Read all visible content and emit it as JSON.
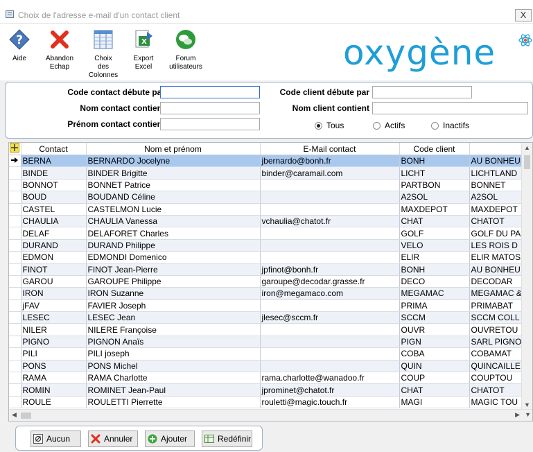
{
  "window": {
    "title": "Choix de l'adresse e-mail d'un contact client",
    "close_label": "X"
  },
  "toolbar": {
    "buttons": [
      {
        "id": "help",
        "label": "Aide",
        "icon": "help-icon"
      },
      {
        "id": "cancel",
        "label": "Abandon\nEchap",
        "icon": "cancel-icon"
      },
      {
        "id": "columns",
        "label": "Choix\ndes\nColonnes",
        "icon": "columns-icon"
      },
      {
        "id": "excel",
        "label": "Export\nExcel",
        "icon": "excel-export-icon"
      },
      {
        "id": "forum",
        "label": "Forum\nutilisateurs",
        "icon": "forum-icon"
      }
    ],
    "logo": "oxygène"
  },
  "filters": {
    "code_contact_label": "Code contact débute par",
    "code_contact_value": "",
    "nom_contact_label": "Nom contact contient",
    "nom_contact_value": "",
    "prenom_contact_label": "Prénom contact contient",
    "prenom_contact_value": "",
    "code_client_label": "Code client débute par",
    "code_client_value": "",
    "nom_client_label": "Nom client contient",
    "nom_client_value": "",
    "radios": [
      {
        "label": "Tous",
        "checked": true
      },
      {
        "label": "Actifs",
        "checked": false
      },
      {
        "label": "Inactifs",
        "checked": false
      }
    ]
  },
  "grid": {
    "columns": [
      "Contact",
      "Nom et prénom",
      "E-Mail contact",
      "Code client",
      ""
    ],
    "rows": [
      [
        "BERNA",
        "BERNARDO Jocelyne",
        "jbernardo@bonh.fr",
        "BONH",
        "AU BONHEUR"
      ],
      [
        "BINDE",
        "BINDER Brigitte",
        "binder@caramail.com",
        "LICHT",
        "LICHTLAND"
      ],
      [
        "BONNOT",
        "BONNET Patrice",
        "",
        "PARTBON",
        "BONNET"
      ],
      [
        "BOUD",
        "BOUDAND Céline",
        "",
        "A2SOL",
        "A2SOL"
      ],
      [
        "CASTEL",
        "CASTELMON Lucie",
        "",
        "MAXDEPOT",
        "MAXDEPOT"
      ],
      [
        "CHAULIA",
        "CHAULIA Vanessa",
        "vchaulia@chatot.fr",
        "CHAT",
        "CHATOT"
      ],
      [
        "DELAF",
        "DELAFORET Charles",
        "",
        "GOLF",
        "GOLF DU PA"
      ],
      [
        "DURAND",
        "DURAND Philippe",
        "",
        "VELO",
        "LES ROIS D"
      ],
      [
        "EDMON",
        "EDMONDI Domenico",
        "",
        "ELIR",
        "ELIR MATOS"
      ],
      [
        "FINOT",
        "FINOT Jean-Pierre",
        "jpfinot@bonh.fr",
        "BONH",
        "AU BONHEU"
      ],
      [
        "GAROU",
        "GAROUPE Philippe",
        "garoupe@decodar.grasse.fr",
        "DECO",
        "DECODAR"
      ],
      [
        "IRON",
        "IRON Suzanne",
        "iron@megamaco.com",
        "MEGAMAC",
        "MEGAMAC &"
      ],
      [
        "jFAV",
        "FAVIER Joseph",
        "",
        "PRIMA",
        "PRIMABAT"
      ],
      [
        "LESEC",
        "LESEC Jean",
        "jlesec@sccm.fr",
        "SCCM",
        "SCCM COLL"
      ],
      [
        "NILER",
        "NILERE Françoise",
        "",
        "OUVR",
        "OUVRETOU"
      ],
      [
        "PIGNO",
        "PIGNON Anaïs",
        "",
        "PIGN",
        "SARL PIGNO"
      ],
      [
        "PILI",
        "PILI joseph",
        "",
        "COBA",
        "COBAMAT"
      ],
      [
        "PONS",
        "PONS Michel",
        "",
        "QUIN",
        "QUINCAILLE"
      ],
      [
        "RAMA",
        "RAMA Charlotte",
        "rama.charlotte@wanadoo.fr",
        "COUP",
        "COUPTOU"
      ],
      [
        "ROMIN",
        "ROMINET Jean-Paul",
        "jprominet@chatot.fr",
        "CHAT",
        "CHATOT"
      ],
      [
        "ROULE",
        "ROULETTI Pierrette",
        "rouletti@magic.touch.fr",
        "MAGI",
        "MAGIC TOU"
      ]
    ],
    "selected_row": 0
  },
  "bottom_buttons": [
    {
      "label": "Aucun",
      "icon": "none-icon"
    },
    {
      "label": "Annuler",
      "icon": "cancel-x-icon"
    },
    {
      "label": "Ajouter",
      "icon": "add-icon"
    },
    {
      "label": "Redéfinir",
      "icon": "redefine-icon"
    }
  ],
  "colors": {
    "selection": "#a9c8ee",
    "alt_row": "#eef2f8",
    "logo": "#1e9ed8",
    "panel_border": "#9fb0c8"
  }
}
